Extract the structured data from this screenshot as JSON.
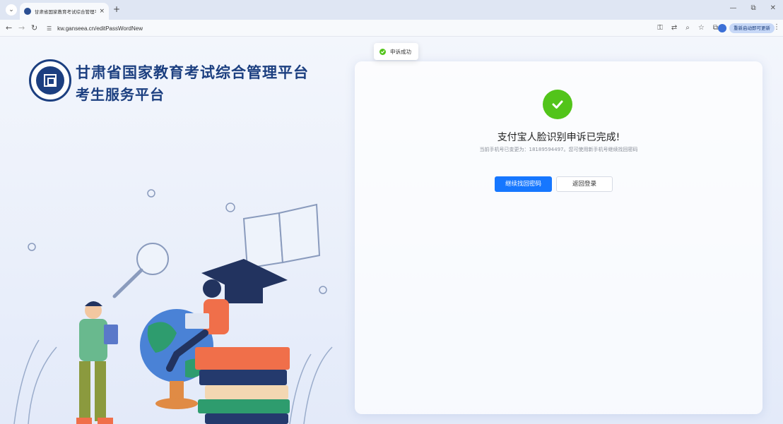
{
  "browser": {
    "tab_title": "甘肃省国家教育考试综合管理平",
    "tab_close": "×",
    "new_tab": "+",
    "tab_menu": "⌄",
    "url": "kw.ganseea.cn/editPassWordNew",
    "update_button": "重新启动即可更新",
    "window_controls": [
      "—",
      "⧉",
      "✕"
    ]
  },
  "header": {
    "title": "甘肃省国家教育考试综合管理平台",
    "subtitle": "考生服务平台"
  },
  "toast": {
    "message": "申诉成功",
    "color": "#52c41a"
  },
  "result": {
    "title": "支付宝人脸识别申诉已完成!",
    "description": "当前手机号已变更为：18189594497。您可使用新手机号继续找回密码",
    "primary_button": "继续找回密码",
    "secondary_button": "返回登录"
  },
  "colors": {
    "brand": "#1c3f80",
    "primary": "#1677ff",
    "success": "#52c41a"
  }
}
